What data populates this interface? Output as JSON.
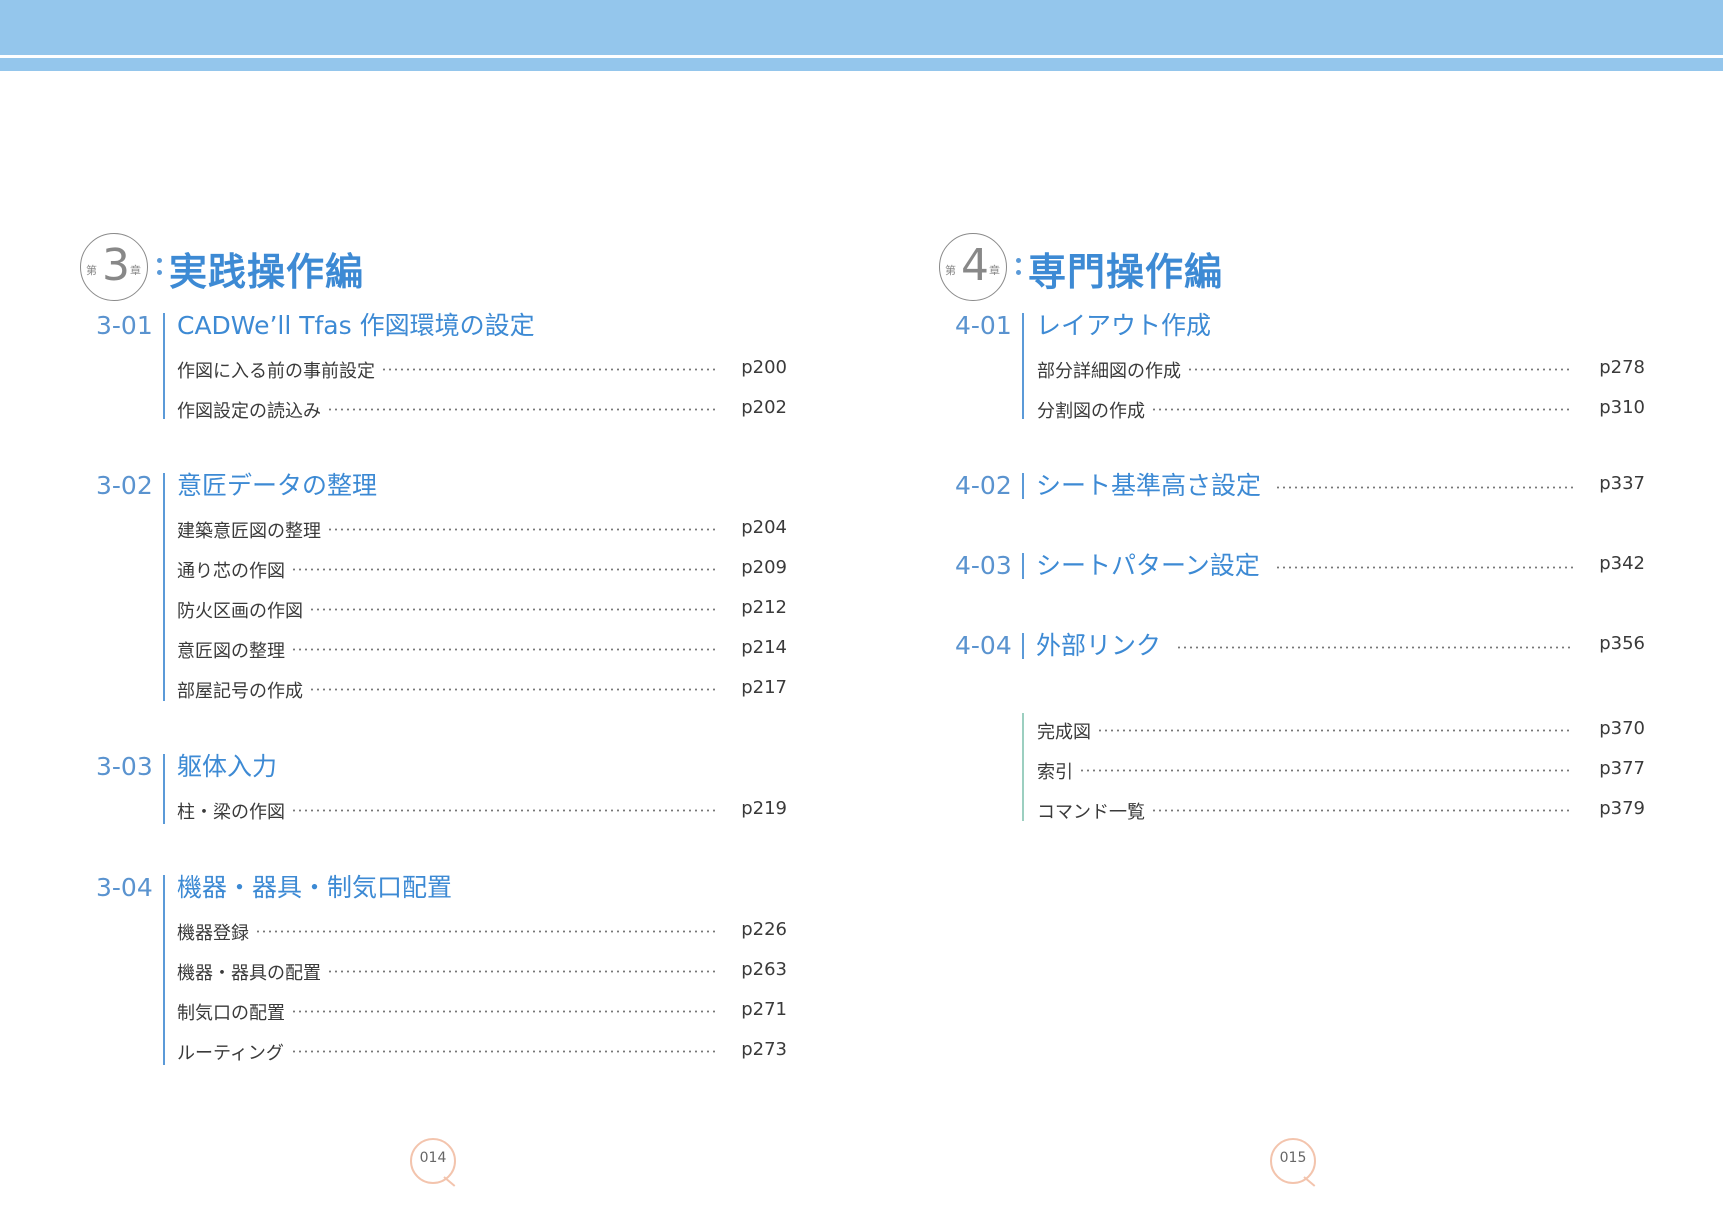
{
  "colors": {
    "header_band": "#94c6ec",
    "accent": "#3d8ad4",
    "section_number": "#5a93cf",
    "page_badge": "#f3c4ad"
  },
  "left": {
    "chapter": {
      "prefix": "第",
      "number": "3",
      "suffix": "章",
      "title": "実践操作編"
    },
    "sections": [
      {
        "num": "3-01",
        "title": "CADWe’ll Tfas 作図環境の設定",
        "items": [
          {
            "label": "作図に入る前の事前設定",
            "page": "p200"
          },
          {
            "label": "作図設定の読込み",
            "page": "p202"
          }
        ]
      },
      {
        "num": "3-02",
        "title": "意匠データの整理",
        "items": [
          {
            "label": "建築意匠図の整理",
            "page": "p204"
          },
          {
            "label": "通り芯の作図",
            "page": "p209"
          },
          {
            "label": "防火区画の作図",
            "page": "p212"
          },
          {
            "label": "意匠図の整理",
            "page": "p214"
          },
          {
            "label": "部屋記号の作成",
            "page": "p217"
          }
        ]
      },
      {
        "num": "3-03",
        "title": "躯体入力",
        "items": [
          {
            "label": "柱・梁の作図",
            "page": "p219"
          }
        ]
      },
      {
        "num": "3-04",
        "title": "機器・器具・制気口配置",
        "items": [
          {
            "label": "機器登録",
            "page": "p226"
          },
          {
            "label": "機器・器具の配置",
            "page": "p263"
          },
          {
            "label": "制気口の配置",
            "page": "p271"
          },
          {
            "label": "ルーティング",
            "page": "p273"
          }
        ]
      }
    ],
    "page_number": "014"
  },
  "right": {
    "chapter": {
      "prefix": "第",
      "number": "4",
      "suffix": "章",
      "title": "専門操作編"
    },
    "sections": [
      {
        "num": "4-01",
        "title": "レイアウト作成",
        "items": [
          {
            "label": "部分詳細図の作成",
            "page": "p278"
          },
          {
            "label": "分割図の作成",
            "page": "p310"
          }
        ]
      },
      {
        "num": "4-02",
        "title": "シート基準高さ設定",
        "page": "p337"
      },
      {
        "num": "4-03",
        "title": "シートパターン設定",
        "page": "p342"
      },
      {
        "num": "4-04",
        "title": "外部リンク",
        "page": "p356"
      }
    ],
    "appendix": [
      {
        "label": "完成図",
        "page": "p370"
      },
      {
        "label": "索引",
        "page": "p377"
      },
      {
        "label": "コマンド一覧",
        "page": "p379"
      }
    ],
    "page_number": "015"
  }
}
